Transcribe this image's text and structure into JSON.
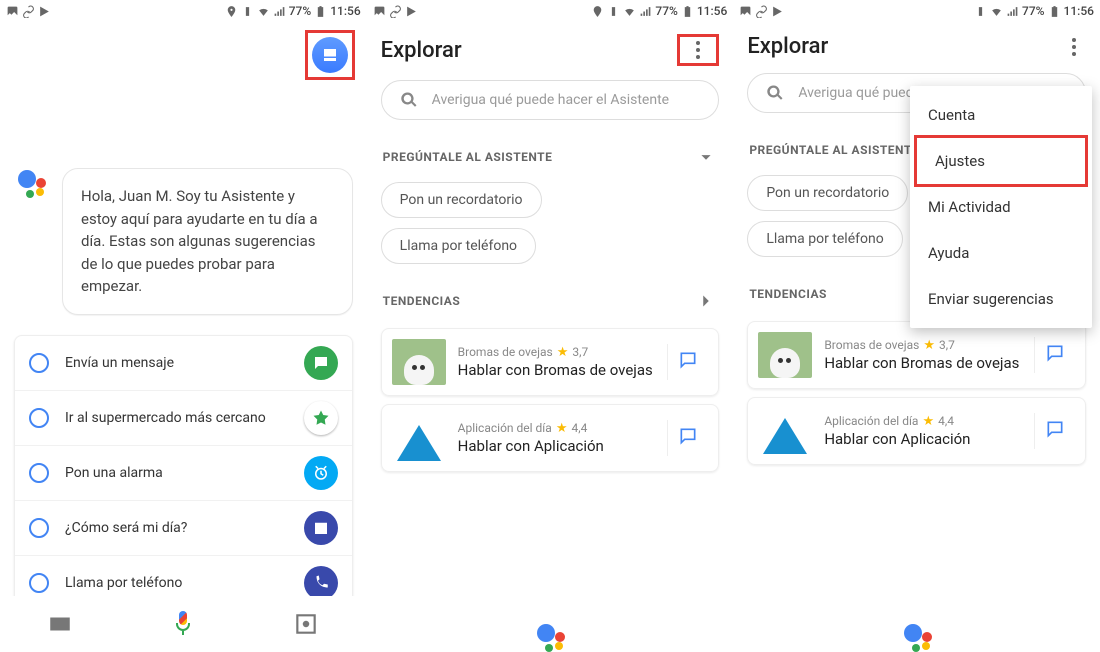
{
  "statusbar": {
    "battery": "77%",
    "time": "11:56"
  },
  "screen1": {
    "greeting": "Hola, Juan M. Soy tu Asistente y estoy aquí para ayudarte en tu día a día. Estas son algunas sugerencias de lo que puedes probar para empezar.",
    "suggestions": [
      {
        "label": "Envía un mensaje",
        "icon": "message-icon",
        "color": "ic-green"
      },
      {
        "label": "Ir al supermercado más cercano",
        "icon": "maps-icon",
        "color": "ic-maps"
      },
      {
        "label": "Pon una alarma",
        "icon": "alarm-icon",
        "color": "ic-blue"
      },
      {
        "label": "¿Cómo será mi día?",
        "icon": "calendar-icon",
        "color": "ic-indigo"
      },
      {
        "label": "Llama por teléfono",
        "icon": "phone-icon",
        "color": "ic-indigo"
      }
    ]
  },
  "explore": {
    "title": "Explorar",
    "search_placeholder": "Averigua qué puede hacer el Asistente",
    "section_ask": "PREGÚNTALE AL ASISTENTE",
    "chips": [
      "Pon un recordatorio",
      "Llama por teléfono"
    ],
    "section_trending": "TENDENCIAS",
    "cards": [
      {
        "pre": "Bromas de ovejas",
        "rating": "3,7",
        "title": "Hablar con Bromas de ovejas"
      },
      {
        "pre": "Aplicación del día",
        "rating": "4,4",
        "title": "Hablar con Aplicación"
      }
    ]
  },
  "menu": {
    "items": [
      "Cuenta",
      "Ajustes",
      "Mi Actividad",
      "Ayuda",
      "Enviar sugerencias"
    ],
    "highlight_index": 1
  }
}
